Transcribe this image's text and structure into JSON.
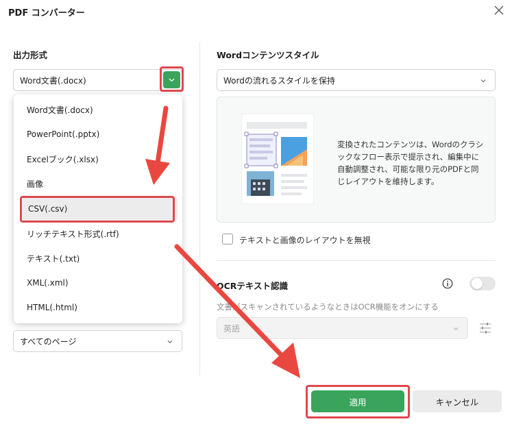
{
  "window": {
    "title": "PDF コンバーター"
  },
  "left": {
    "output_format_label": "出力形式",
    "format_selected": "Word文書(.docx)",
    "page_range_selected": "すべてのページ",
    "menu_items": [
      "Word文書(.docx)",
      "PowerPoint(.pptx)",
      "Excelブック(.xlsx)",
      "画像",
      "CSV(.csv)",
      "リッチテキスト形式(.rtf)",
      "テキスト(.txt)",
      "XML(.xml)",
      "HTML(.html)"
    ],
    "menu_highlighted_index": 4
  },
  "right": {
    "style_section_label": "Wordコンテンツスタイル",
    "style_selected": "Wordの流れるスタイルを保持",
    "preview_description": "変換されたコンテンツは、Wordのクラシックなフロー表示で提示され、編集中に自動調整され、可能な限り元のPDFと同じレイアウトを維持します。",
    "ignore_layout_checkbox_label": "テキストと画像のレイアウトを無視",
    "ignore_layout_checked": false,
    "ocr_title": "OCRテキスト認識",
    "ocr_enabled": false,
    "ocr_description": "文書がスキャンされているようなときはOCR機能をオンにする",
    "ocr_language": "英語"
  },
  "footer": {
    "apply_label": "適用",
    "cancel_label": "キャンセル"
  },
  "colors": {
    "accent_green": "#3aa35c",
    "annotation_red": "#e0474c"
  }
}
